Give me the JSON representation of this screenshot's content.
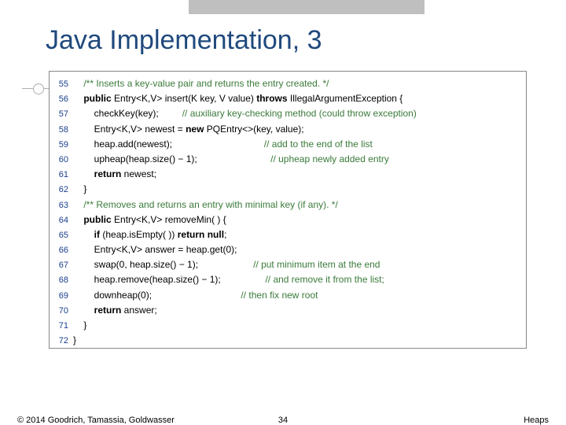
{
  "title": "Java Implementation, 3",
  "lines": [
    {
      "n": "55",
      "indent": 0,
      "segs": [
        {
          "c": "doccomment",
          "t": "/** Inserts a key-value pair and returns the entry created. */"
        }
      ]
    },
    {
      "n": "56",
      "indent": 0,
      "segs": [
        {
          "c": "kw",
          "t": "public"
        },
        {
          "t": " Entry<K,V> insert(K key, V value) "
        },
        {
          "c": "kw",
          "t": "throws"
        },
        {
          "t": " IllegalArgumentException {"
        }
      ]
    },
    {
      "n": "57",
      "indent": 2,
      "segs": [
        {
          "t": "checkKey(key);         "
        },
        {
          "c": "comment-inline",
          "t": "// auxiliary key-checking method (could throw exception)"
        }
      ]
    },
    {
      "n": "58",
      "indent": 2,
      "segs": [
        {
          "t": "Entry<K,V> newest = "
        },
        {
          "c": "kw",
          "t": "new"
        },
        {
          "t": " PQEntry<>(key, value);"
        }
      ]
    },
    {
      "n": "59",
      "indent": 2,
      "segs": [
        {
          "t": "heap.add(newest);                                   "
        },
        {
          "c": "comment-inline",
          "t": "// add to the end of the list"
        }
      ]
    },
    {
      "n": "60",
      "indent": 2,
      "segs": [
        {
          "t": "upheap(heap.size() − 1);                            "
        },
        {
          "c": "comment-inline",
          "t": "// upheap newly added entry"
        }
      ]
    },
    {
      "n": "61",
      "indent": 2,
      "segs": [
        {
          "c": "kw",
          "t": "return"
        },
        {
          "t": " newest;"
        }
      ]
    },
    {
      "n": "62",
      "indent": 0,
      "segs": [
        {
          "t": "}"
        }
      ]
    },
    {
      "n": "63",
      "indent": 0,
      "segs": [
        {
          "c": "doccomment",
          "t": "/** Removes and returns an entry with minimal key (if any). */"
        }
      ]
    },
    {
      "n": "64",
      "indent": 0,
      "segs": [
        {
          "c": "kw",
          "t": "public"
        },
        {
          "t": " Entry<K,V> removeMin( ) {"
        }
      ]
    },
    {
      "n": "65",
      "indent": 2,
      "segs": [
        {
          "c": "kw",
          "t": "if"
        },
        {
          "t": " (heap.isEmpty( )) "
        },
        {
          "c": "kw",
          "t": "return null"
        },
        {
          "t": ";"
        }
      ]
    },
    {
      "n": "66",
      "indent": 2,
      "segs": [
        {
          "t": "Entry<K,V> answer = heap.get(0);"
        }
      ]
    },
    {
      "n": "67",
      "indent": 2,
      "segs": [
        {
          "t": "swap(0, heap.size() − 1);                     "
        },
        {
          "c": "comment-inline",
          "t": "// put minimum item at the end"
        }
      ]
    },
    {
      "n": "68",
      "indent": 2,
      "segs": [
        {
          "t": "heap.remove(heap.size() − 1);                 "
        },
        {
          "c": "comment-inline",
          "t": "// and remove it from the list;"
        }
      ]
    },
    {
      "n": "69",
      "indent": 2,
      "segs": [
        {
          "t": "downheap(0);                                  "
        },
        {
          "c": "comment-inline",
          "t": "// then fix new root"
        }
      ]
    },
    {
      "n": "70",
      "indent": 2,
      "segs": [
        {
          "c": "kw",
          "t": "return"
        },
        {
          "t": " answer;"
        }
      ]
    },
    {
      "n": "71",
      "indent": 0,
      "segs": [
        {
          "t": "}"
        }
      ]
    },
    {
      "n": "72",
      "indent": -2,
      "segs": [
        {
          "t": "}"
        }
      ]
    }
  ],
  "footer": {
    "left": "© 2014 Goodrich, Tamassia, Goldwasser",
    "center": "34",
    "right": "Heaps"
  }
}
